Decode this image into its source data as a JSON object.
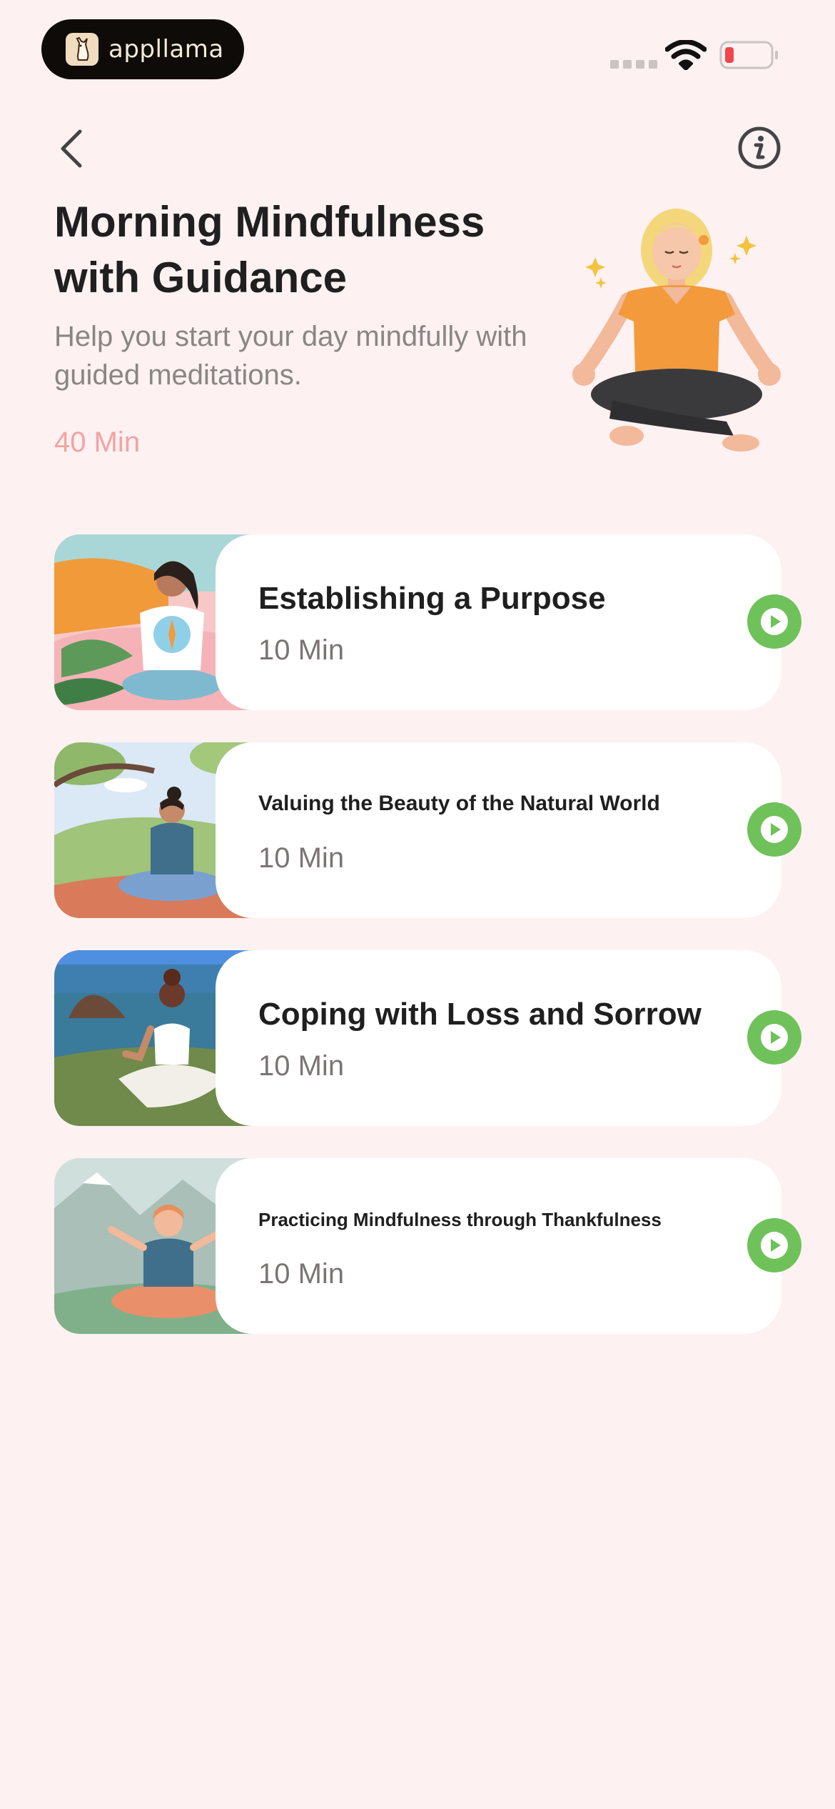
{
  "status_bar": {
    "brand_name": "appllama",
    "battery_color": "#f0464b"
  },
  "header": {
    "back_icon": "chevron-left-icon",
    "info_icon": "info-icon"
  },
  "program": {
    "title": "Morning Mindfulness with Guidance",
    "subtitle": "Help you start your day mindfully with guided meditations.",
    "duration": "40 Min"
  },
  "sessions": [
    {
      "title": "Establishing a Purpose",
      "duration": "10 Min"
    },
    {
      "title": "Valuing the Beauty of the Natural World",
      "duration": "10 Min"
    },
    {
      "title": "Coping with Loss and Sorrow",
      "duration": "10 Min"
    },
    {
      "title": "Practicing Mindfulness through Thankfulness",
      "duration": "10 Min"
    }
  ],
  "colors": {
    "background": "#fdf1f1",
    "accent_duration": "#f2a3a3",
    "play_button": "#6fc25a"
  }
}
